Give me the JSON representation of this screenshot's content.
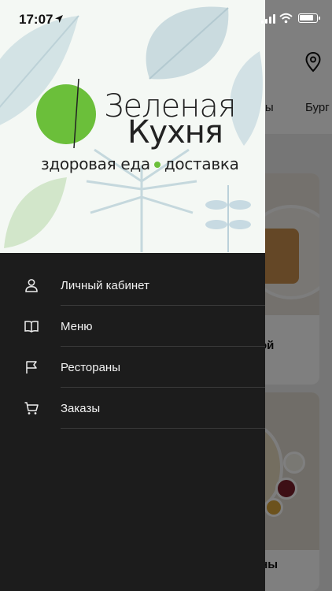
{
  "status_bar": {
    "time": "17:07"
  },
  "background": {
    "tabs": [
      "ты",
      "Бург"
    ],
    "cards": [
      {
        "title": "ой"
      },
      {
        "title": "ины"
      }
    ]
  },
  "drawer": {
    "logo": {
      "line1": "Зеленая",
      "line2": "Кухня",
      "tagline_left": "здоровая еда",
      "tagline_right": "доставка",
      "accent_color": "#6bbf3a"
    },
    "menu": [
      {
        "label": "Личный кабинет",
        "icon": "user-icon"
      },
      {
        "label": "Меню",
        "icon": "book-icon"
      },
      {
        "label": "Рестораны",
        "icon": "flag-icon"
      },
      {
        "label": "Заказы",
        "icon": "cart-icon"
      }
    ]
  }
}
